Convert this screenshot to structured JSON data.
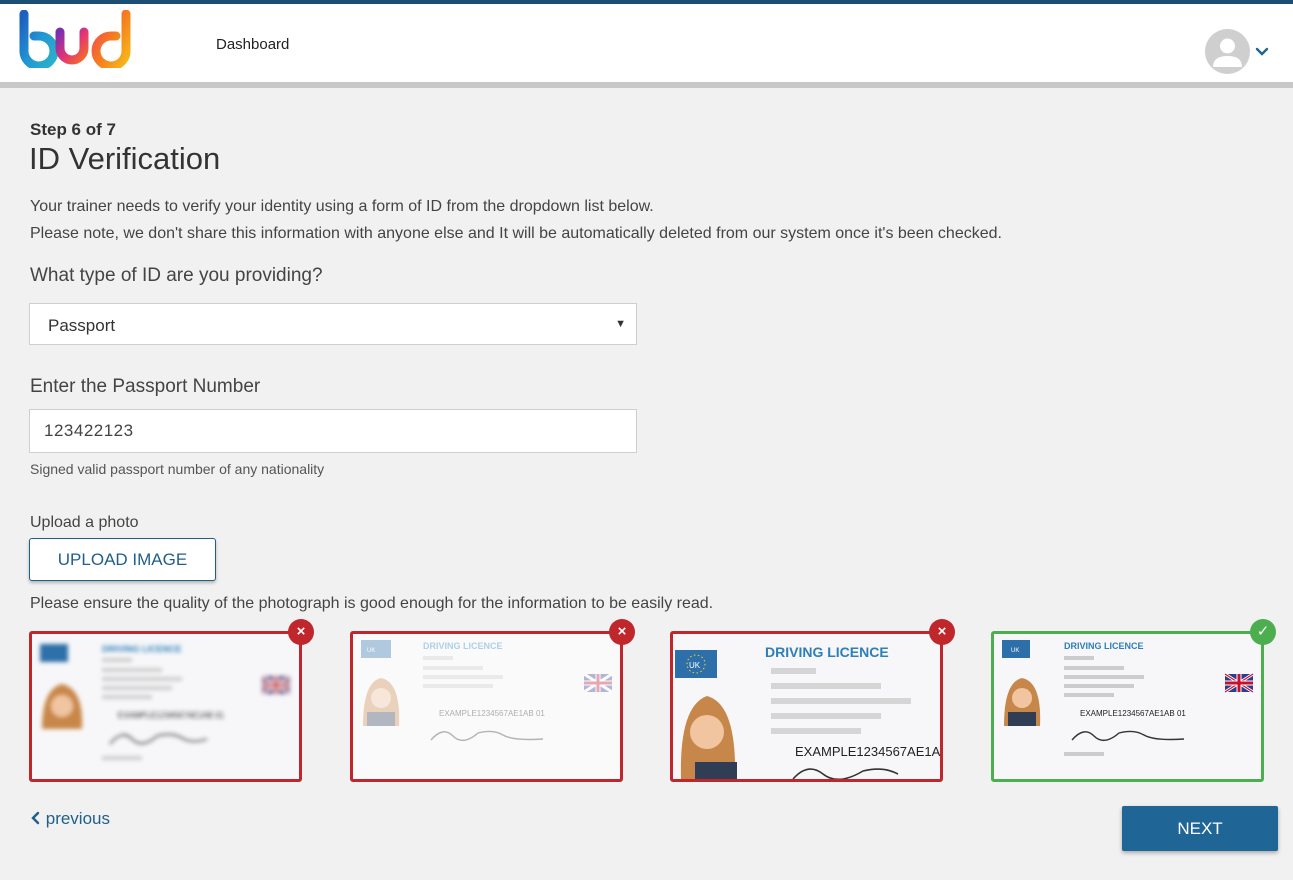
{
  "header": {
    "nav_dashboard": "Dashboard",
    "logo_text": "bud"
  },
  "step": {
    "indicator": "Step 6 of 7",
    "title": "ID Verification",
    "intro_line1": "Your trainer needs to verify your identity using a form of ID from the dropdown list below.",
    "intro_line2": "Please note, we don't share this information with anyone else and It will be automatically deleted from our system once it's been checked."
  },
  "id_type": {
    "label": "What type of ID are you providing?",
    "selected": "Passport"
  },
  "passport_number": {
    "label": "Enter the Passport Number",
    "value": "123422123",
    "hint": "Signed valid passport number of any nationality"
  },
  "upload": {
    "label": "Upload a photo",
    "button_label": "UPLOAD IMAGE",
    "quality_note": "Please ensure the quality of the photograph is good enough for the information to be easily read."
  },
  "examples": [
    {
      "status": "bad",
      "reason": "blurry",
      "card_title": "DRIVING LICENCE",
      "card_number": "EXAMPLE1234567AE1AB 01",
      "badge": "×"
    },
    {
      "status": "bad",
      "reason": "washed-out",
      "card_title": "DRIVING LICENCE",
      "card_number": "EXAMPLE1234567AE1AB 01",
      "badge": "×"
    },
    {
      "status": "bad",
      "reason": "cropped",
      "card_title": "DRIVING LICENCE",
      "card_number": "EXAMPLE1234567AE1A",
      "badge": "×"
    },
    {
      "status": "good",
      "reason": "clear",
      "card_title": "DRIVING LICENCE",
      "card_number": "EXAMPLE1234567AE1AB 01",
      "badge": "✓"
    }
  ],
  "nav": {
    "previous_label": "previous",
    "next_label": "NEXT"
  },
  "colors": {
    "brand_blue": "#1f6595",
    "error_red": "#c0272d",
    "ok_green": "#4cae4f",
    "background": "#f1f1f1"
  }
}
